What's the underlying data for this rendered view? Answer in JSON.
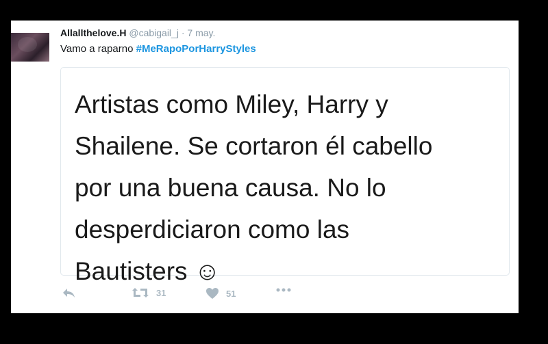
{
  "tweet": {
    "display_name": "Allallthelove.H",
    "handle": "@cabigail_j",
    "separator": "·",
    "date": "7 may.",
    "text_prefix": "Vamo a raparno ",
    "hashtag": "#MeRapoPorHarryStyles",
    "image_text": {
      "line1": "Artistas como Miley, Harry y",
      "line2": "Shailene. Se cortaron él cabello",
      "line3": "por una buena causa. No lo",
      "line4": "desperdiciaron como las",
      "line5": "Bautisters ☺"
    },
    "actions": {
      "reply_icon": "reply-icon",
      "retweet_icon": "retweet-icon",
      "retweet_count": "31",
      "like_icon": "heart-icon",
      "like_count": "51",
      "more_icon": "more-icon"
    }
  },
  "colors": {
    "background": "#000000",
    "card": "#ffffff",
    "link": "#1b95e0",
    "muted": "#8899a6",
    "action": "#aab8c2"
  }
}
